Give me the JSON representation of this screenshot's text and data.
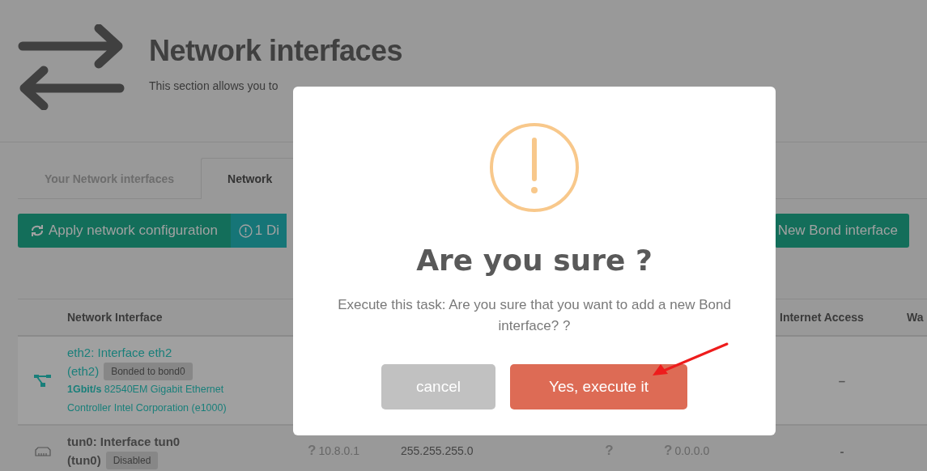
{
  "header": {
    "title": "Network interfaces",
    "subtitle": "This section allows you to"
  },
  "tabs": [
    {
      "label": "Your Network interfaces",
      "selected": false
    },
    {
      "label": "Network",
      "selected": true
    }
  ],
  "toolbar": {
    "apply_button": "Apply network configuration",
    "status_button": "1 Di",
    "new_bond_button": "New Bond interface"
  },
  "table": {
    "columns": [
      "Network Interface",
      "Internet Access",
      "Wa"
    ],
    "rows": [
      {
        "kind": "bonded",
        "selected": true,
        "name": "eth2: Interface eth2",
        "device": "(eth2)",
        "badge": "Bonded to bond0",
        "speed": "1Gbit/s",
        "description": "82540EM Gigabit Ethernet Controller Intel Corporation (e1000)",
        "internet_access": "–"
      },
      {
        "kind": "port",
        "selected": false,
        "name": "tun0: Interface tun0",
        "device": "(tun0)",
        "badge": "Disabled",
        "ip": {
          "flag": "?",
          "text": "10.8.0.1"
        },
        "netmask": "255.255.255.0",
        "column_5": {
          "flag": "?"
        },
        "gateway": {
          "flag": "?",
          "text": "0.0.0.0"
        },
        "internet_access": "-"
      }
    ]
  },
  "dialog": {
    "title": "Are you sure ?",
    "message": "Execute this task: Are you sure that you want to add a new Bond interface? ?",
    "buttons": [
      {
        "label": "cancel",
        "kind": "cancel"
      },
      {
        "label": "Yes, execute it",
        "kind": "confirm"
      }
    ]
  }
}
